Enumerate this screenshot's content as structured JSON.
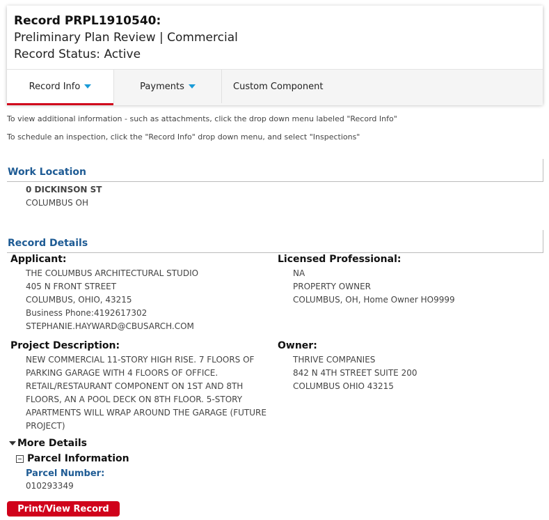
{
  "header": {
    "record_id": "Record PRPL1910540:",
    "record_type": "Preliminary Plan Review | Commercial",
    "record_status": "Record Status: Active"
  },
  "tabs": [
    {
      "label": "Record Info",
      "has_dropdown": true,
      "active": true
    },
    {
      "label": "Payments",
      "has_dropdown": true,
      "active": false
    },
    {
      "label": "Custom Component",
      "has_dropdown": false,
      "active": false
    }
  ],
  "notes": {
    "info": "To view additional information - such as attachments, click the drop down menu labeled \"Record Info\"",
    "inspection": "To schedule an inspection, click the \"Record Info\" drop down menu, and select \"Inspections\""
  },
  "work_location": {
    "title": "Work Location",
    "street": "0 DICKINSON ST",
    "city": "COLUMBUS OH"
  },
  "record_details": {
    "title": "Record Details",
    "applicant": {
      "label": "Applicant:",
      "name": "THE COLUMBUS ARCHITECTURAL STUDIO",
      "address": "405 N FRONT STREET",
      "city": "COLUMBUS, OHIO, 43215",
      "phone": "Business Phone:4192617302",
      "email": "STEPHANIE.HAYWARD@CBUSARCH.COM"
    },
    "licensed_professional": {
      "label": "Licensed Professional:",
      "name": "NA",
      "type": "PROPERTY OWNER",
      "city": "COLUMBUS, OH, Home Owner HO9999"
    },
    "project_description": {
      "label": "Project Description:",
      "text": "NEW COMMERCIAL 11-STORY HIGH RISE. 7 FLOORS OF PARKING GARAGE WITH 4 FLOORS OF OFFICE. RETAIL/RESTAURANT COMPONENT ON 1ST AND 8TH FLOORS, AN A POOL DECK ON 8TH FLOOR. 5-STORY APARTMENTS WILL WRAP AROUND THE GARAGE (FUTURE PROJECT)"
    },
    "owner": {
      "label": "Owner:",
      "name": "THRIVE COMPANIES",
      "address": "842 N 4TH STREET SUITE 200",
      "city": "COLUMBUS OHIO 43215"
    }
  },
  "more_details": {
    "label": "More Details",
    "parcel_section": "Parcel Information",
    "parcel_number_label": "Parcel Number:",
    "parcel_number": "010293349"
  },
  "actions": {
    "print_label": "Print/View Record"
  },
  "colors": {
    "accent_red": "#d0021b",
    "heading_blue": "#1e5b94",
    "caret_blue": "#1a9bd7"
  }
}
